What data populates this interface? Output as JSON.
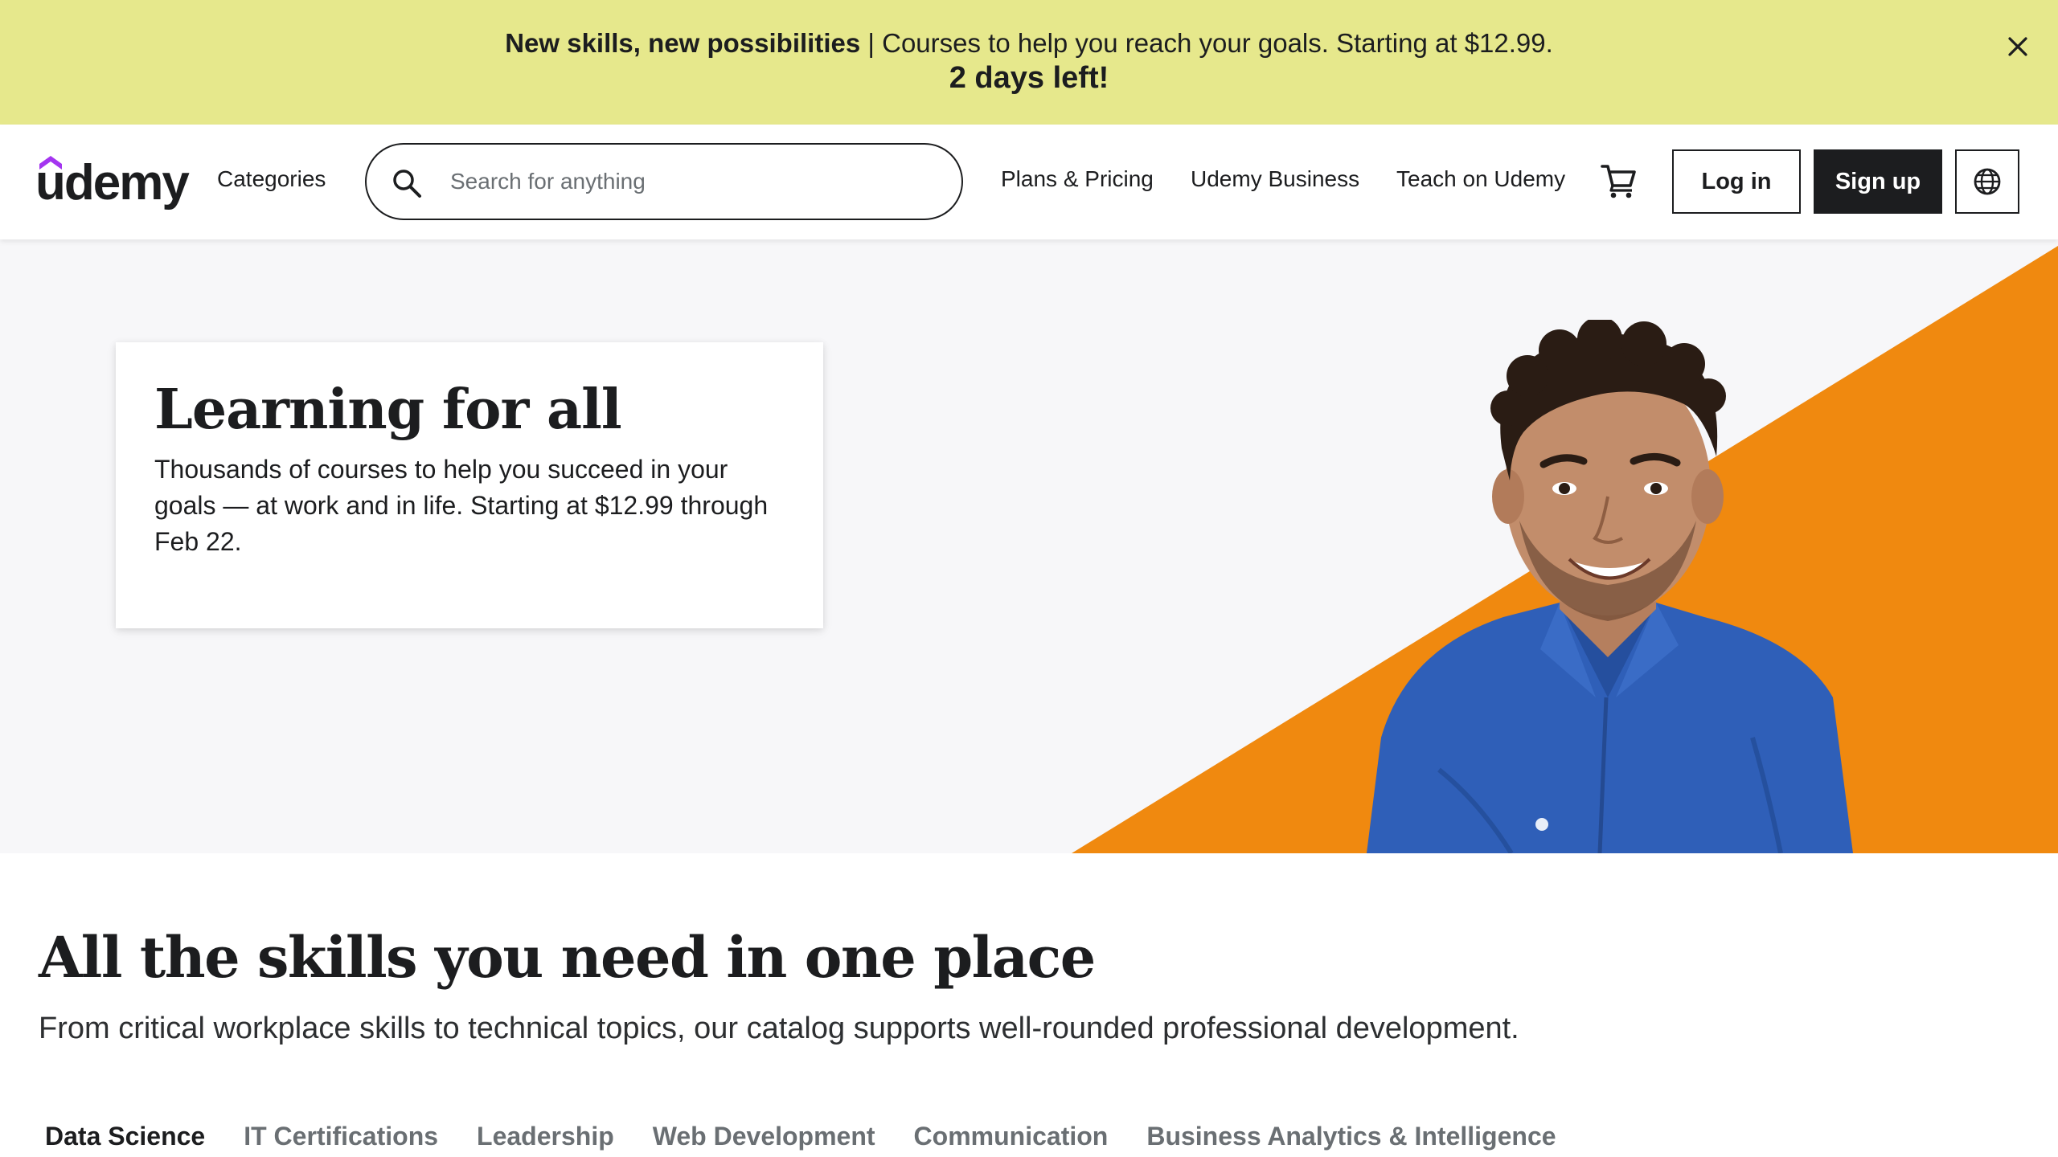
{
  "promo": {
    "headline": "New skills, new possibilities",
    "separator": " | ",
    "text": "Courses to help you reach your goals. Starting at $12.99.",
    "countdown": "2 days left!",
    "close_icon": "close-icon"
  },
  "header": {
    "logo_text": "udemy",
    "categories_label": "Categories",
    "search_placeholder": "Search for anything",
    "search_value": "",
    "links": {
      "plans": "Plans & Pricing",
      "business": "Udemy Business",
      "teach": "Teach on Udemy"
    },
    "cart_icon": "cart-icon",
    "login_label": "Log in",
    "signup_label": "Sign up",
    "language_icon": "globe-icon"
  },
  "hero": {
    "title": "Learning for all",
    "text": "Thousands of courses to help you succeed in your goals — at work and in life. Starting at $12.99 through Feb 22."
  },
  "skills": {
    "title": "All the skills you need in one place",
    "subtitle": "From critical workplace skills to technical topics, our catalog supports well-rounded professional development.",
    "tabs": [
      {
        "label": "Data Science",
        "active": true
      },
      {
        "label": "IT Certifications",
        "active": false
      },
      {
        "label": "Leadership",
        "active": false
      },
      {
        "label": "Web Development",
        "active": false
      },
      {
        "label": "Communication",
        "active": false
      },
      {
        "label": "Business Analytics & Intelligence",
        "active": false
      }
    ]
  },
  "colors": {
    "brand_purple": "#a435f0",
    "banner_yellow": "#e6e88c",
    "hero_orange": "#f0890f",
    "text_dark": "#1c1d1f",
    "shirt_blue": "#2f5fb8"
  }
}
